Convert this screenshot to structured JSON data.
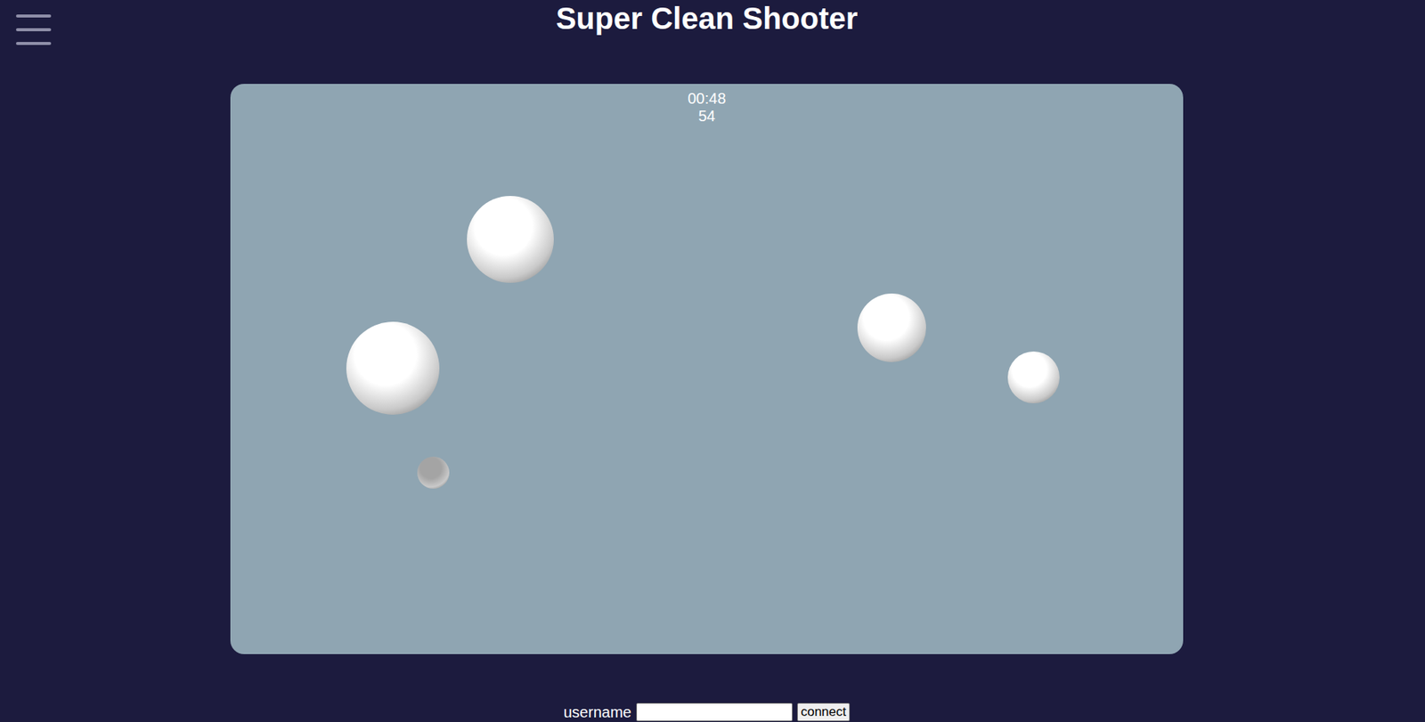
{
  "header": {
    "title": "Super Clean Shooter",
    "menu_open": false
  },
  "hud": {
    "time": "00:48",
    "score": "54"
  },
  "balls": [
    {
      "color": "#ffffff"
    },
    {
      "color": "#ffffff"
    },
    {
      "color": "#ffffff"
    },
    {
      "color": "#ffffff"
    },
    {
      "color": "#a4a4a4"
    }
  ],
  "login": {
    "label": "username",
    "value": "",
    "button": "connect"
  }
}
